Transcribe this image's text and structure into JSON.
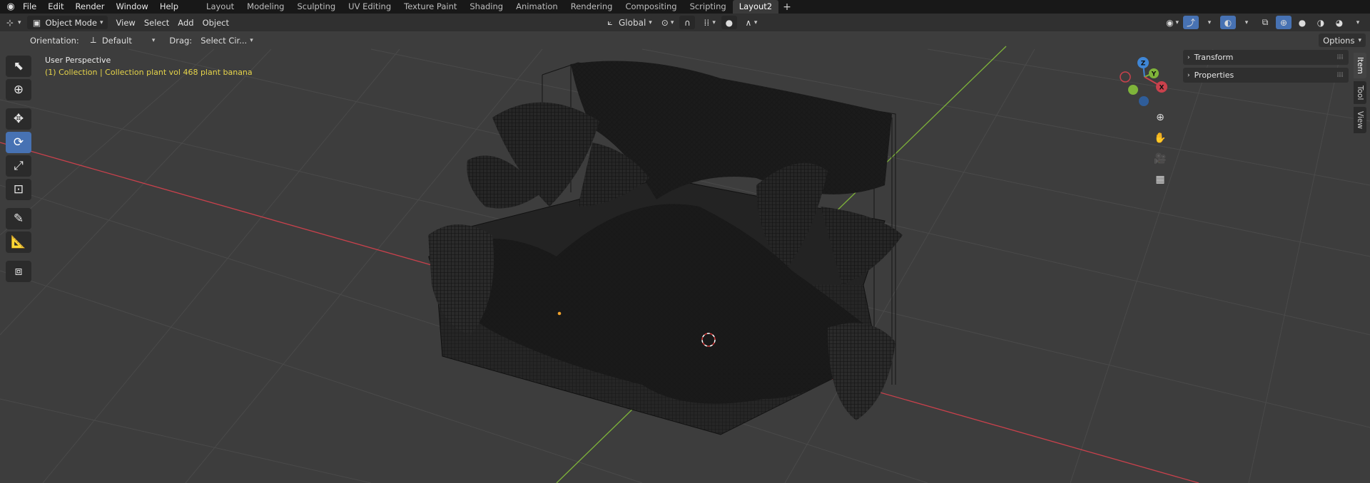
{
  "app": {
    "menu": [
      "File",
      "Edit",
      "Render",
      "Window",
      "Help"
    ],
    "workspaces": [
      {
        "label": "Layout",
        "active": false
      },
      {
        "label": "Modeling",
        "active": false
      },
      {
        "label": "Sculpting",
        "active": false
      },
      {
        "label": "UV Editing",
        "active": false
      },
      {
        "label": "Texture Paint",
        "active": false
      },
      {
        "label": "Shading",
        "active": false
      },
      {
        "label": "Animation",
        "active": false
      },
      {
        "label": "Rendering",
        "active": false
      },
      {
        "label": "Compositing",
        "active": false
      },
      {
        "label": "Scripting",
        "active": false
      },
      {
        "label": "Layout2",
        "active": true
      }
    ],
    "add_workspace": "+"
  },
  "header": {
    "mode": "Object Mode",
    "menus": [
      "View",
      "Select",
      "Add",
      "Object"
    ],
    "transform_orientation": "Global"
  },
  "subheader": {
    "orientation_label": "Orientation:",
    "orientation_value": "Default",
    "drag_label": "Drag:",
    "drag_value": "Select Cir...",
    "options_label": "Options"
  },
  "viewport": {
    "perspective": "User Perspective",
    "collection": "(1) Collection | Collection plant vol 468 plant banana",
    "axes": {
      "x": "X",
      "y": "Y",
      "z": "Z"
    }
  },
  "npanel": {
    "sections": [
      "Transform",
      "Properties"
    ],
    "tabs": [
      {
        "label": "Item",
        "active": true
      },
      {
        "label": "Tool",
        "active": false
      },
      {
        "label": "View",
        "active": false
      }
    ]
  },
  "colors": {
    "x_axis": "#c9414c",
    "y_axis": "#7fb43a",
    "z_axis": "#3f86d6",
    "active_tool": "#4772b3",
    "info_text": "#e6d44a"
  }
}
